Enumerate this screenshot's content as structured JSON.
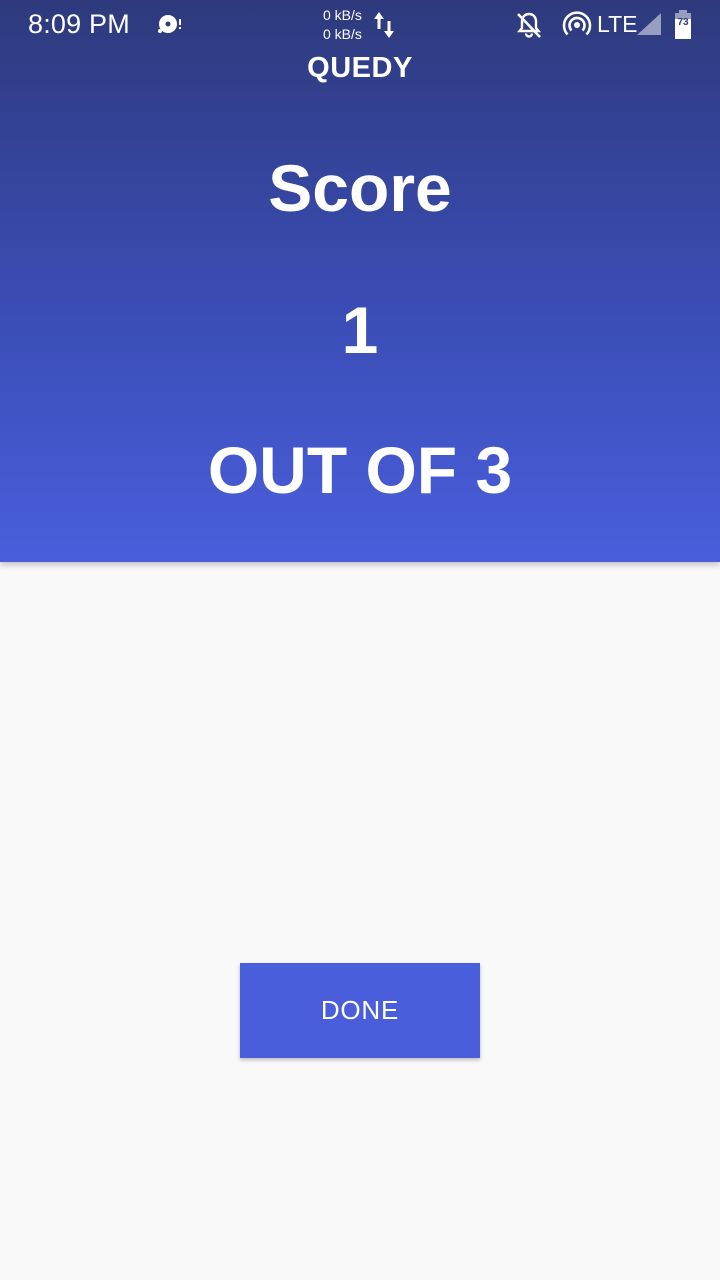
{
  "status_bar": {
    "time": "8:09 PM",
    "speed_up": "0 kB/s",
    "speed_down": "0 kB/s",
    "network": "LTE",
    "battery": "73",
    "icons": [
      "disc-icon",
      "data-arrows-icon",
      "bell-off-icon",
      "hotspot-icon",
      "signal-icon",
      "battery-icon"
    ]
  },
  "header": {
    "app_title": "QUEDY",
    "score_label": "Score",
    "score_value": "1",
    "score_total": "OUT OF 3"
  },
  "actions": {
    "done_label": "DONE"
  },
  "colors": {
    "header_top": "#2e3a7c",
    "header_bottom": "#4a5edc",
    "button": "#4a5edc",
    "background": "#f9f9fa"
  }
}
